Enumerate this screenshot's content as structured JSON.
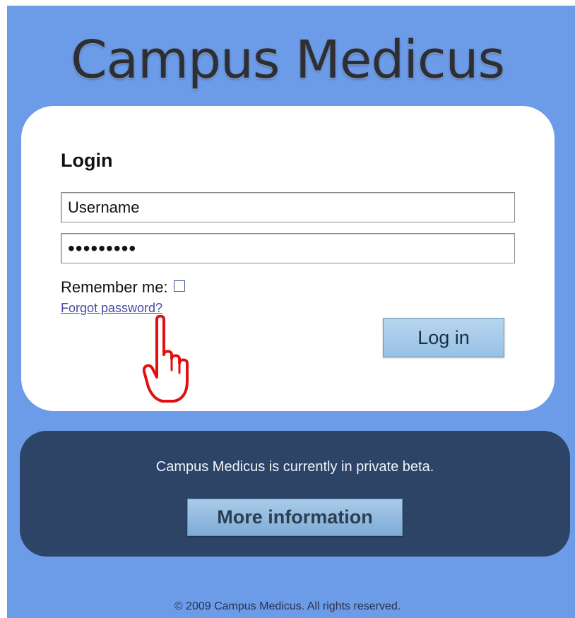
{
  "brand": {
    "logo_text": "Campus Medicus"
  },
  "login": {
    "heading": "Login",
    "username_value": "Username",
    "password_value": "•••••••••",
    "remember_label": "Remember me:",
    "remember_checked": false,
    "forgot_link": "Forgot password?",
    "submit_label": "Log in"
  },
  "beta": {
    "message": "Campus Medicus is currently in private beta.",
    "more_info_label": "More information"
  },
  "footer": {
    "copyright": "© 2009 Campus Medicus. All rights reserved."
  },
  "colors": {
    "page_background": "#6c9be7",
    "card_background": "#ffffff",
    "beta_panel": "#2e4467",
    "button_light_blue": "#a9cdea",
    "link": "#4a4aa6",
    "cursor_outline": "#e11010"
  },
  "icons": {
    "cursor": "pointing-hand-cursor-icon"
  }
}
